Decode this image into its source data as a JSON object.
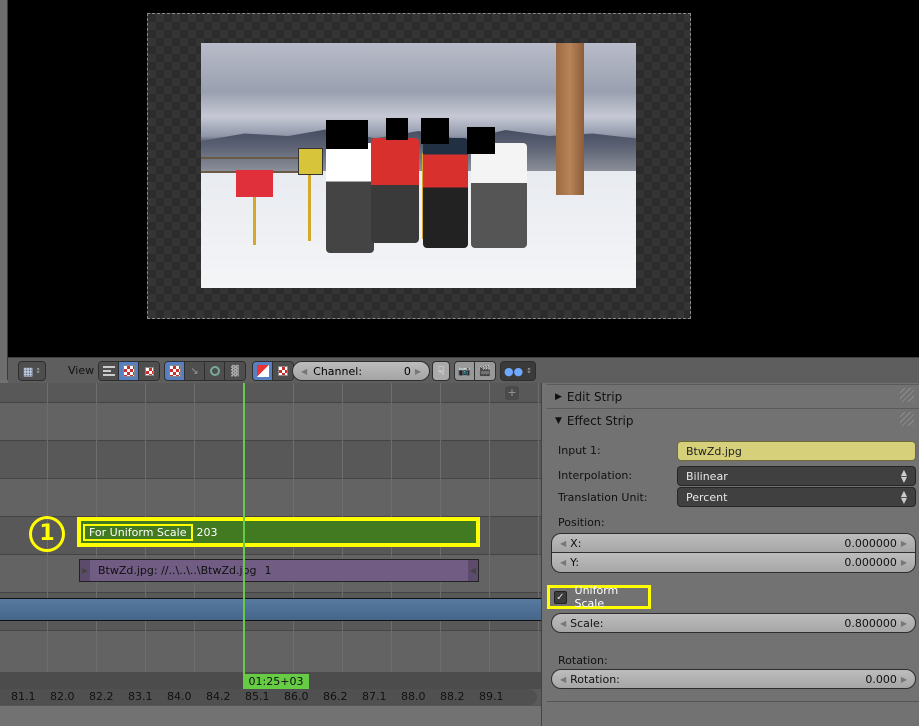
{
  "preview": {
    "image_description": "Group of four people in ski gear on snowy mountain summit with faces redacted",
    "redactions": 4
  },
  "header": {
    "editor_type_icon": "sequencer-icon",
    "view_menu_label": "View",
    "view_type_buttons": [
      {
        "icon": "sequencer-view-icon",
        "active": false
      },
      {
        "icon": "preview-view-icon",
        "active": true
      },
      {
        "icon": "sequencer-preview-view-icon",
        "active": false
      }
    ],
    "display_mode_buttons": [
      {
        "icon": "image-display-icon",
        "active": true
      },
      {
        "icon": "luma-waveform-icon",
        "active": false
      },
      {
        "icon": "vectorscope-icon",
        "active": false
      },
      {
        "icon": "histogram-icon",
        "active": false
      }
    ],
    "channel_buttons": [
      {
        "icon": "color-alpha-icon",
        "active": true
      },
      {
        "icon": "checkerboard-icon",
        "active": false
      }
    ],
    "channel_field": {
      "label": "Channel:",
      "value": "0"
    },
    "ghost_icon": "ghost-icon",
    "render_still_icon": "render-still-icon",
    "render_animation_icon": "render-animation-icon",
    "proxy_icon": "proxy-icon"
  },
  "timeline": {
    "callout_number": "1",
    "effect_strip": {
      "name": "For Uniform Scale",
      "length": "203",
      "color": "#417a20"
    },
    "image_strip": {
      "name": "BtwZd.jpg: //..\\..\\..\\BtwZd.jpg",
      "length": "1",
      "color": "#715c84"
    },
    "meta_strip_color": "#4e6f94",
    "playhead_label": "01:25+03",
    "playhead_color": "#66cc44",
    "ruler_ticks": [
      "81.1",
      "82.0",
      "82.2",
      "83.1",
      "84.0",
      "84.2",
      "85.1",
      "86.0",
      "86.2",
      "87.1",
      "88.0",
      "88.2",
      "89.1"
    ]
  },
  "properties": {
    "edit_strip": {
      "label": "Edit Strip",
      "expanded": false
    },
    "effect_strip": {
      "label": "Effect Strip",
      "expanded": true,
      "input1_label": "Input 1:",
      "input1_value": "BtwZd.jpg",
      "interpolation_label": "Interpolation:",
      "interpolation_value": "Bilinear",
      "translation_unit_label": "Translation Unit:",
      "translation_unit_value": "Percent",
      "position_label": "Position:",
      "x_label": "X:",
      "x_value": "0.000000",
      "y_label": "Y:",
      "y_value": "0.000000",
      "uniform_scale_label": "Uniform Scale",
      "uniform_scale_checked": true,
      "scale_label": "Scale:",
      "scale_value": "0.800000",
      "rotation_section_label": "Rotation:",
      "rotation_label": "Rotation:",
      "rotation_value": "0.000"
    }
  },
  "highlight_color": "#ffff00"
}
